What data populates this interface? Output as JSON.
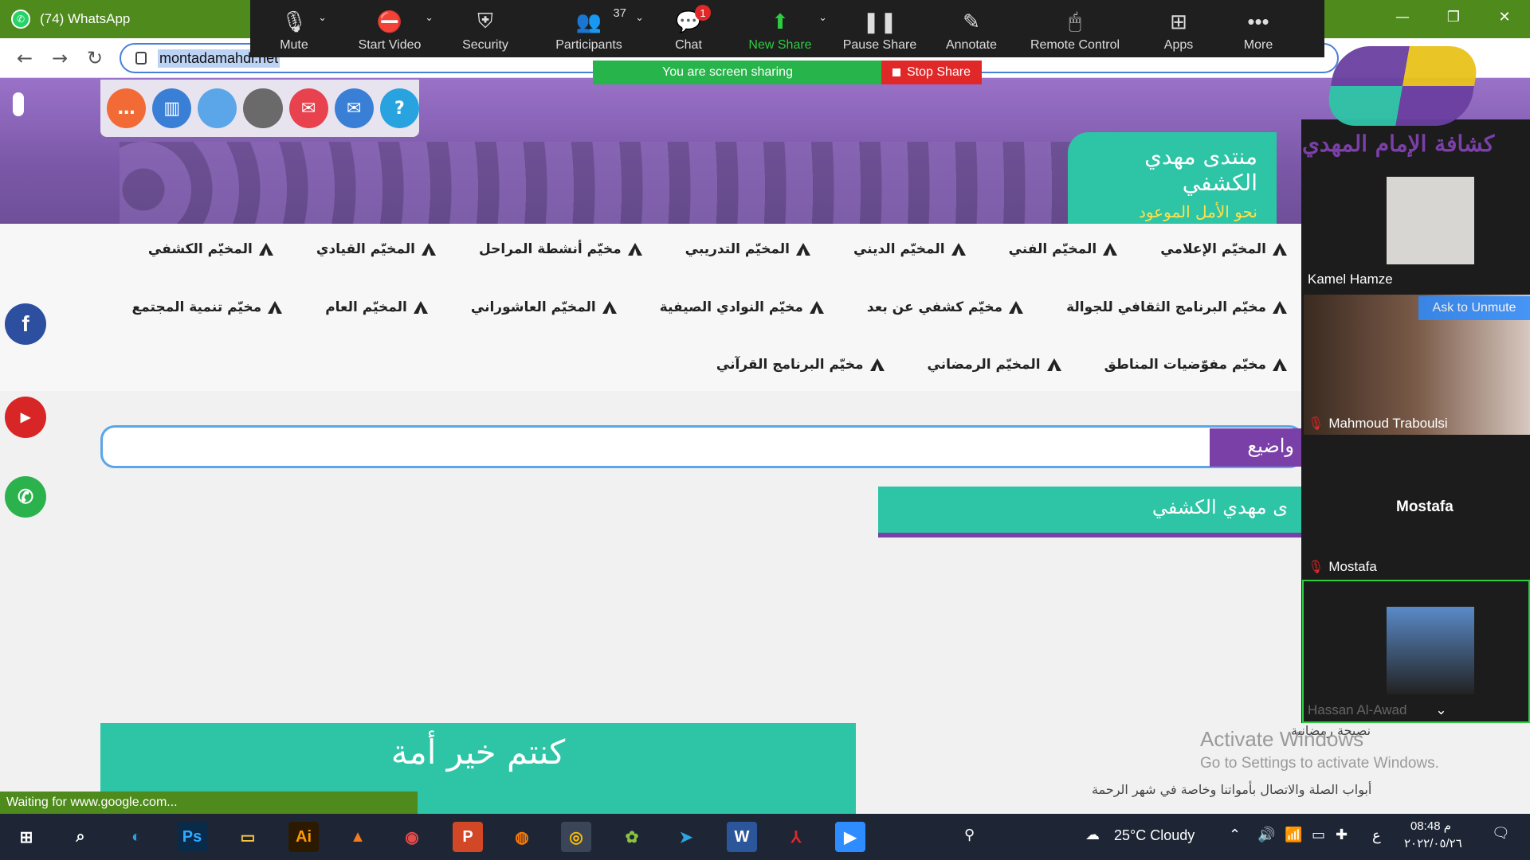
{
  "browser": {
    "tab_title": "(74) WhatsApp",
    "url": "montadamahdi.net",
    "status_text": "Waiting for www.google.com..."
  },
  "zoom": {
    "toolbar": [
      {
        "id": "mute",
        "label": "Mute",
        "icon": "mic-icon"
      },
      {
        "id": "video",
        "label": "Start Video",
        "icon": "video-off-icon"
      },
      {
        "id": "security",
        "label": "Security",
        "icon": "shield-icon"
      },
      {
        "id": "participants",
        "label": "Participants",
        "icon": "people-icon",
        "count": "37"
      },
      {
        "id": "chat",
        "label": "Chat",
        "icon": "chat-icon",
        "badge": "1"
      },
      {
        "id": "newshare",
        "label": "New Share",
        "icon": "share-up-icon"
      },
      {
        "id": "pauseshare",
        "label": "Pause Share",
        "icon": "pause-icon"
      },
      {
        "id": "annotate",
        "label": "Annotate",
        "icon": "pen-icon"
      },
      {
        "id": "remote",
        "label": "Remote Control",
        "icon": "mouse-icon"
      },
      {
        "id": "apps",
        "label": "Apps",
        "icon": "apps-icon"
      },
      {
        "id": "more",
        "label": "More",
        "icon": "dots-icon"
      }
    ],
    "sharing_text": "You are screen sharing",
    "stop_share": "Stop Share",
    "ask_unmute": "Ask to Unmute",
    "participants": {
      "p1": "Kamel Hamze",
      "p2": "Mahmoud Traboulsi",
      "p3_big": "Mostafa",
      "p3": "Mostafa",
      "p4": "Hassan Al-Awad"
    }
  },
  "site": {
    "logo_text": "كشافة الإمام المهدي",
    "forum_title": "منتدى مهدي الكشفي",
    "forum_slogan": "نحو الأمل الموعود",
    "menu_row1": [
      "المخيّم الكشفي",
      "المخيّم القيادي",
      "مخيّم أنشطة المراحل",
      "المخيّم التدريبي",
      "المخيّم الديني",
      "المخيّم الفني",
      "المخيّم الإعلامي"
    ],
    "menu_row2": [
      "مخيّم تنمية المجتمع",
      "المخيّم العام",
      "المخيّم العاشوراني",
      "مخيّم النوادي الصيفية",
      "مخيّم كشفي عن بعد",
      "مخيّم البرنامج الثقافي للجوالة"
    ],
    "menu_row3": [
      "مخيّم البرنامج القرآني",
      "المخيّم الرمضاني",
      "مخيّم مفوّضيات المناطق"
    ],
    "topics_label": "واضيع",
    "green_strip": "ى مهدي الكشفي",
    "verse": "كنتم خير أمة",
    "side_text1": "نصيحة رمضانية",
    "side_text2": "أبواب الصلة والاتصال بأمواتنا وخاصة في شهر الرحمة"
  },
  "windows": {
    "activate_title": "Activate Windows",
    "activate_sub": "Go to Settings to activate Windows.",
    "weather": "25°C  Cloudy",
    "lang": "ع",
    "time": "08:48 م",
    "date": "٢٠٢٢/٠٥/٢٦"
  }
}
